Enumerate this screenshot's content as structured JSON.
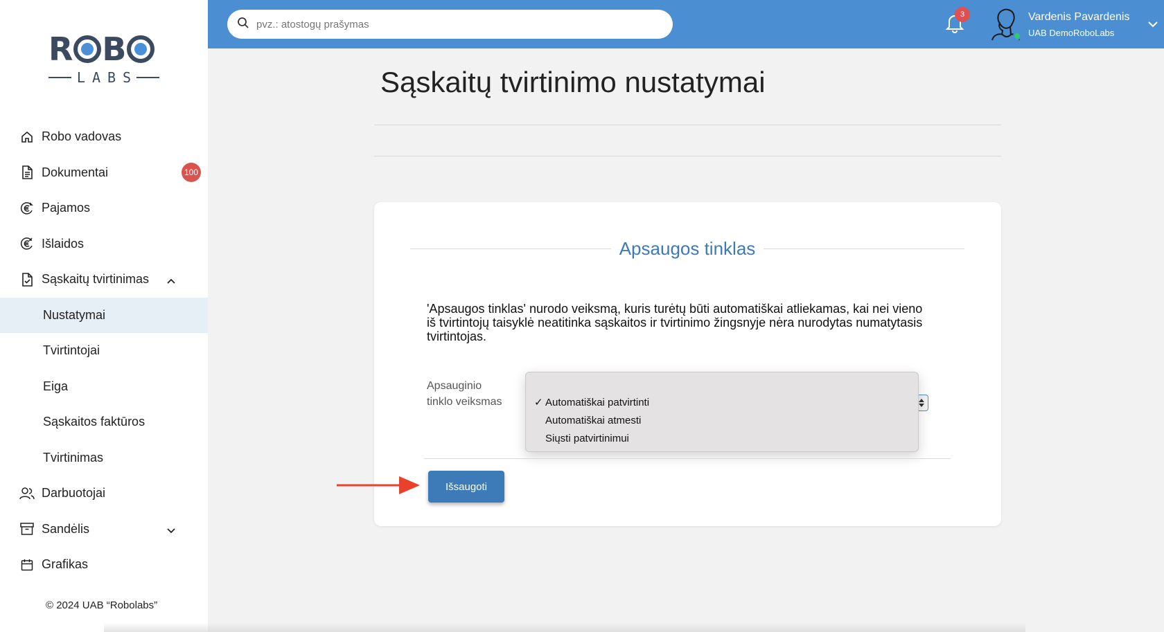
{
  "brand": {
    "logo_text": "ROBO LABS"
  },
  "sidebar": {
    "items": [
      {
        "label": "Robo vadovas",
        "icon": "home-icon"
      },
      {
        "label": "Dokumentai",
        "icon": "document-icon",
        "badge": "100"
      },
      {
        "label": "Pajamos",
        "icon": "euro-in-icon"
      },
      {
        "label": "Išlaidos",
        "icon": "euro-out-icon"
      },
      {
        "label": "Sąskaitų tvirtinimas",
        "icon": "file-check-icon",
        "expanded": true
      },
      {
        "label": "Nustatymai",
        "active": true
      },
      {
        "label": "Tvirtintojai"
      },
      {
        "label": "Eiga"
      },
      {
        "label": "Sąskaitos faktūros"
      },
      {
        "label": "Tvirtinimas"
      },
      {
        "label": "Darbuotojai",
        "icon": "users-icon"
      },
      {
        "label": "Sandėlis",
        "icon": "archive-icon",
        "expanded": false
      },
      {
        "label": "Grafikas",
        "icon": "calendar-icon"
      }
    ],
    "copyright": "© 2024 UAB “Robolabs”"
  },
  "topbar": {
    "search_placeholder": "pvz.: atostogų prašymas",
    "notifications_count": "3",
    "user_name": "Vardenis Pavardenis",
    "user_company": "UAB DemoRoboLabs",
    "accent_color": "#4b8fd2"
  },
  "main": {
    "title": "Sąskaitų tvirtinimo nustatymai",
    "card": {
      "title": "Apsaugos tinklas",
      "description": "'Apsaugos tinklas' nurodo veiksmą, kuris turėtų būti automatiškai atliekamas, kai nei vieno iš tvirtintojų taisyklė neatitinka sąskaitos ir tvirtinimo žingsnyje nėra nurodytas numatytasis tvirtintojas.",
      "field_label": "Apsauginio tinklo veiksmas",
      "options": [
        {
          "label": "Automatiškai patvirtinti",
          "selected": true
        },
        {
          "label": "Automatiškai atmesti",
          "selected": false
        },
        {
          "label": "Siųsti patvirtinimui",
          "selected": false
        }
      ],
      "check_mark": "✓",
      "save_label": "Išsaugoti"
    }
  }
}
